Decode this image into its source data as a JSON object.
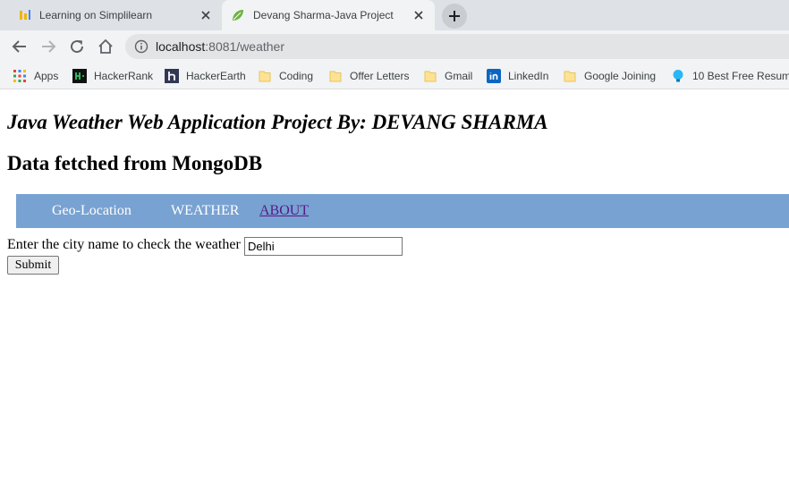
{
  "tabs": [
    {
      "title": "Learning on Simplilearn",
      "icon": "simplilearn-icon",
      "active": false
    },
    {
      "title": "Devang Sharma-Java Project",
      "icon": "spring-leaf-icon",
      "active": true
    }
  ],
  "address_bar": {
    "host": "localhost",
    "rest": ":8081/weather"
  },
  "bookmarks": [
    {
      "label": "Apps",
      "icon": "apps-grid-icon"
    },
    {
      "label": "HackerRank",
      "icon": "hackerrank-icon"
    },
    {
      "label": "HackerEarth",
      "icon": "hackerearth-icon"
    },
    {
      "label": "Coding",
      "icon": "folder-icon"
    },
    {
      "label": "Offer Letters",
      "icon": "folder-icon"
    },
    {
      "label": "Gmail",
      "icon": "folder-icon"
    },
    {
      "label": "LinkedIn",
      "icon": "linkedin-icon"
    },
    {
      "label": "Google Joining",
      "icon": "folder-icon"
    },
    {
      "label": "10 Best Free Resum...",
      "icon": "lightbulb-icon"
    }
  ],
  "page": {
    "heading": "Java Weather Web Application Project By: DEVANG SHARMA",
    "subheading": "Data fetched from MongoDB",
    "nav": {
      "geo": "Geo-Location",
      "weather": "WEATHER",
      "about": "ABOUT"
    },
    "form": {
      "label": "Enter the city name to check the weather",
      "city_value": "Delhi",
      "submit_label": "Submit"
    }
  },
  "colors": {
    "nav_bar": "#78a2d1",
    "link_visited": "#551a8b",
    "tab_strip": "#dee1e6"
  }
}
